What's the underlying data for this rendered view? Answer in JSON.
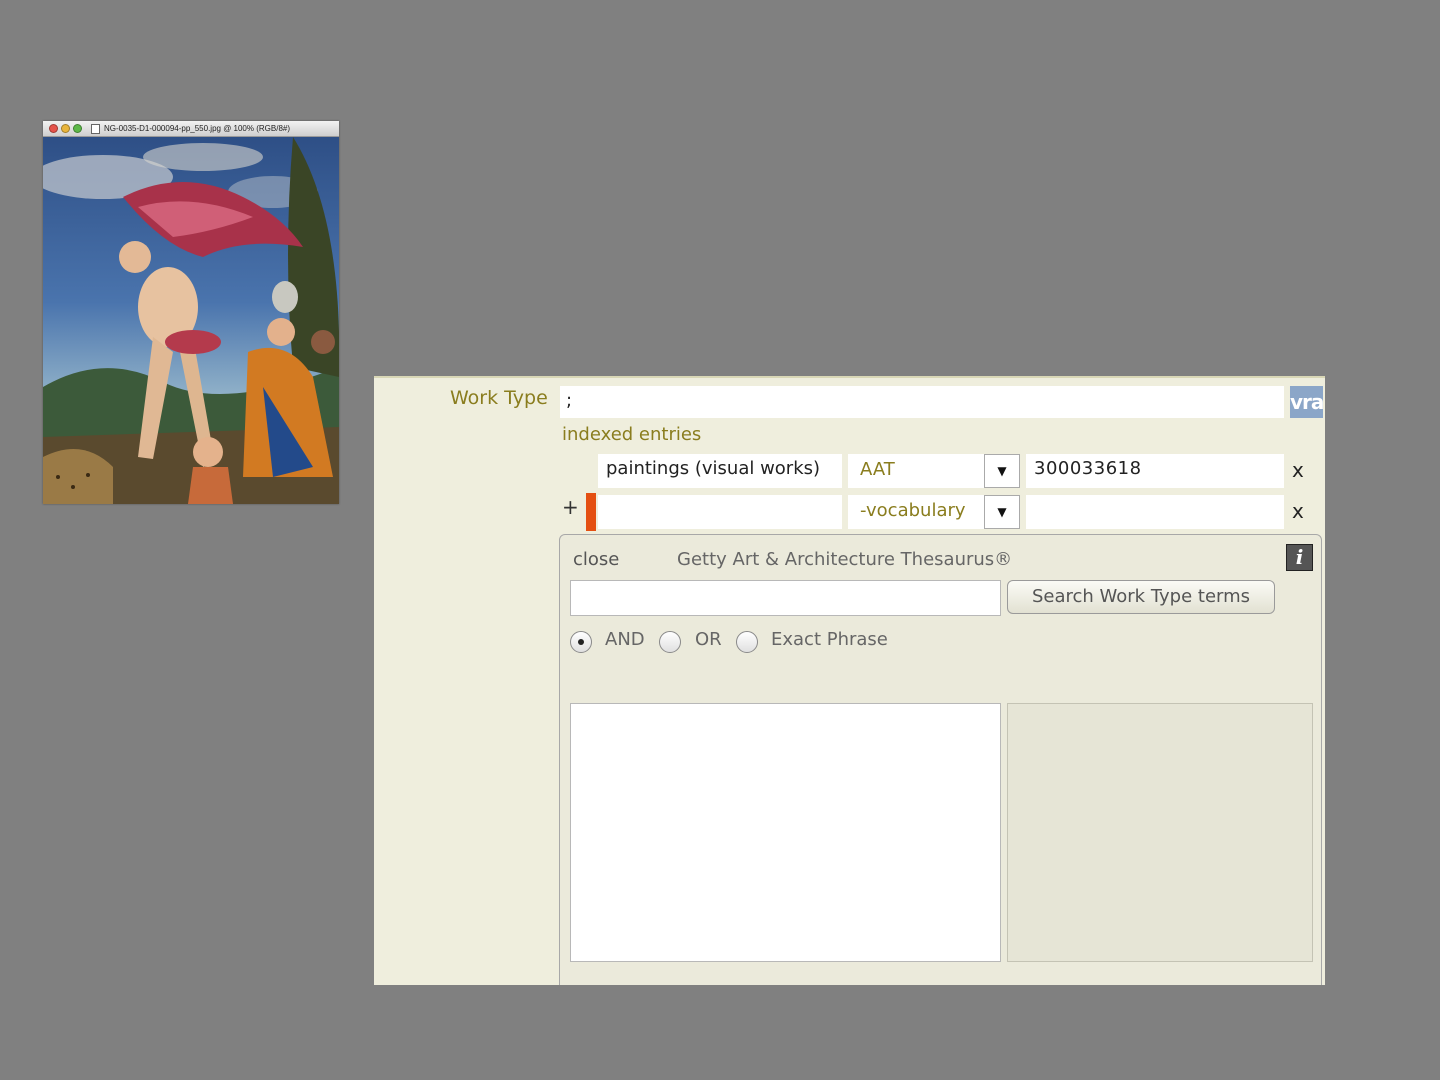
{
  "image_window": {
    "title": "NG-0035-D1-000094-pp_550.jpg @ 100% (RGB/8#)"
  },
  "form": {
    "work_type_label": "Work Type",
    "work_type_value": ";",
    "vra_badge": "vra",
    "indexed_entries_label": "indexed entries",
    "entries": [
      {
        "term": "paintings (visual works)",
        "vocabulary": "AAT",
        "id": "300033618",
        "remove": "x"
      },
      {
        "term": "",
        "vocabulary": "-vocabulary",
        "id": "",
        "remove": "x"
      }
    ],
    "add_symbol": "+",
    "dropdown_arrow": "▼",
    "colors": {
      "required_marker": "#e44f12",
      "label": "#8a7d1e",
      "panel_bg": "#efeedd"
    }
  },
  "search": {
    "close_label": "close",
    "thesaurus_title": "Getty Art & Architecture Thesaurus®",
    "info_icon": "i",
    "query": "",
    "button_label": "Search Work Type terms",
    "options": [
      {
        "label": "AND",
        "checked": true
      },
      {
        "label": "OR",
        "checked": false
      },
      {
        "label": "Exact Phrase",
        "checked": false
      }
    ]
  }
}
